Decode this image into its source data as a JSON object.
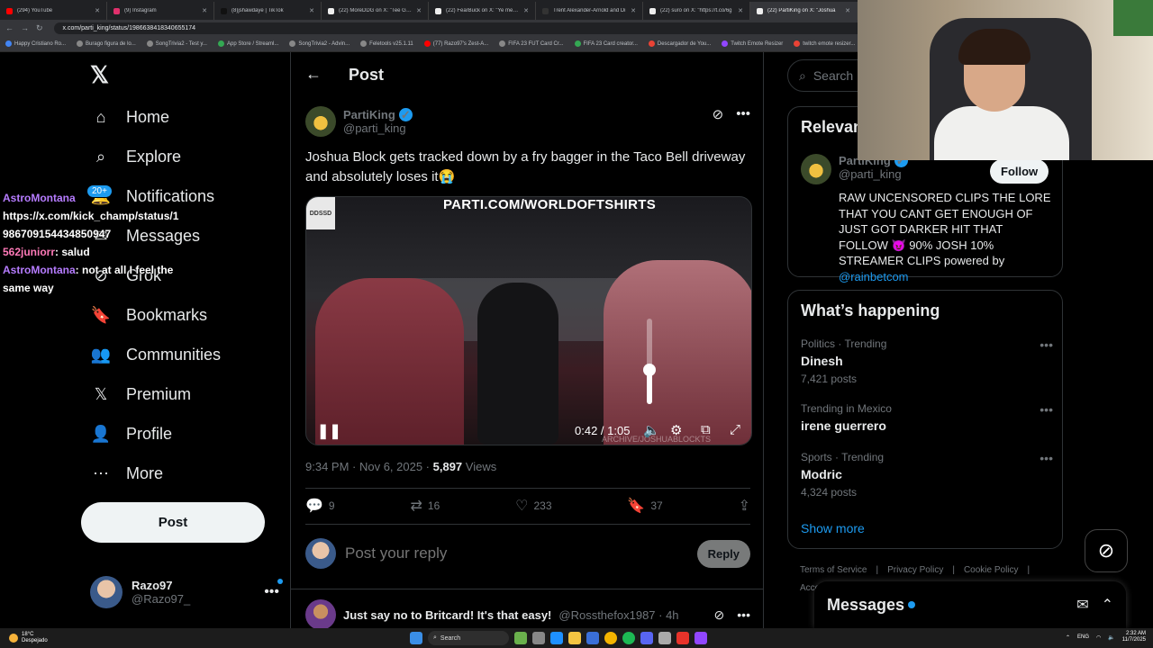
{
  "browser": {
    "tabs": [
      {
        "label": "(294) YouTube",
        "color": "#ff0000"
      },
      {
        "label": "(9) Instagram",
        "color": "#e1306c"
      },
      {
        "label": "(8)jshawdaye | TikTok",
        "color": "#111111"
      },
      {
        "label": "(22) MoreDDG on X: \"Tee Gsiss",
        "color": "#eeeeee"
      },
      {
        "label": "(22) FearBuck on X: \"Ye met wi",
        "color": "#eeeeee"
      },
      {
        "label": "Trent Alexander-Arnold and Di",
        "color": "#333333"
      },
      {
        "label": "(22) suro on X: \"https://t.co/6g",
        "color": "#eeeeee"
      },
      {
        "label": "(22) PartiKing on X: \"Joshua",
        "color": "#eeeeee",
        "active": true
      }
    ],
    "url": "x.com/parti_king/status/1986638418340655174",
    "bookmarks": [
      {
        "label": "Happy Cristiano Ro...",
        "color": "#4285f4"
      },
      {
        "label": "Burago figura de lo...",
        "color": "#888888"
      },
      {
        "label": "SongTrivia2 - Test y...",
        "color": "#888888"
      },
      {
        "label": "App Store / Streaml...",
        "color": "#34a853"
      },
      {
        "label": "SongTrivia2 - Advin...",
        "color": "#888888"
      },
      {
        "label": "Feletools v25.1.11",
        "color": "#888888"
      },
      {
        "label": "(77) Razo97's Zest-A...",
        "color": "#ff0000"
      },
      {
        "label": "FIFA 23 FUT Card Cr...",
        "color": "#888888"
      },
      {
        "label": "FIFA 23 Card creator...",
        "color": "#34a853"
      },
      {
        "label": "Descargador de You...",
        "color": "#ea4335"
      },
      {
        "label": "Twitch Emote Resizer",
        "color": "#9146ff"
      },
      {
        "label": "twitch emote resizer...",
        "color": "#ea4335"
      }
    ]
  },
  "nav": {
    "items": [
      {
        "label": "Home",
        "icon": "home-icon"
      },
      {
        "label": "Explore",
        "icon": "search-icon"
      },
      {
        "label": "Notifications",
        "icon": "bell-icon"
      },
      {
        "label": "Messages",
        "icon": "mail-icon"
      },
      {
        "label": "Grok",
        "icon": "grok-icon"
      },
      {
        "label": "Bookmarks",
        "icon": "bookmark-icon"
      },
      {
        "label": "Communities",
        "icon": "communities-icon"
      },
      {
        "label": "Premium",
        "icon": "x-icon"
      },
      {
        "label": "Profile",
        "icon": "person-icon"
      },
      {
        "label": "More",
        "icon": "more-circle-icon"
      }
    ],
    "notifications_badge": "20+",
    "post_label": "Post",
    "account": {
      "name": "Razo97",
      "handle": "@Razo97_"
    }
  },
  "chat_overlay": {
    "lines": [
      {
        "user": "AstroMontana",
        "text": ""
      },
      {
        "user": "",
        "text": "https://x.com/kick_champ/status/1986709154434850947"
      },
      {
        "user": "562juniorr",
        "text": ": salud"
      },
      {
        "user": "AstroMontana",
        "text": ": not at all I feel the same way"
      }
    ]
  },
  "main": {
    "title": "Post",
    "author": {
      "name": "PartiKing",
      "handle": "@parti_king"
    },
    "text": "Joshua Block gets tracked down by a fry bagger in the Taco Bell driveway and absolutely loses it😭",
    "video": {
      "brand": "PARTI.COM/WORLDOFTSHIRTS",
      "watermark": "DDSSD",
      "time": "0:42 / 1:05",
      "handle_watermark": "ARCHIVE/JOSHUABLOCKTS",
      "volume_level": 0.4
    },
    "timestamp": "9:34 PM · Nov 6, 2025 · ",
    "views_count": "5,897",
    "views_label": " Views",
    "stats": {
      "replies": "9",
      "reposts": "16",
      "likes": "233",
      "bookmarks": "37"
    },
    "reply_placeholder": "Post your reply",
    "reply_button": "Reply",
    "next_post": {
      "text": "Just say no to Britcard! It's that easy!",
      "handle": "@Rossthefox1987 · 4h"
    }
  },
  "right": {
    "search_placeholder": "Search",
    "relevant": {
      "title": "Relevant people",
      "name": "PartiKing",
      "handle": "@parti_king",
      "follow": "Follow",
      "bio": "RAW UNCENSORED CLIPS THE LORE THAT YOU CANT GET ENOUGH OF JUST GOT DARKER HIT THAT FOLLOW 😈 90% JOSH 10% STREAMER CLIPS powered by ",
      "bio_link": "@rainbetcom"
    },
    "happening": {
      "title": "What’s happening",
      "trends": [
        {
          "context": "Politics · Trending",
          "name": "Dinesh",
          "count": "7,421 posts"
        },
        {
          "context": "Trending in Mexico",
          "name": "irene guerrero",
          "count": ""
        },
        {
          "context": "Sports · Trending",
          "name": "Modric",
          "count": "4,324 posts"
        }
      ],
      "show_more": "Show more"
    },
    "footer": [
      "Terms of Service",
      "Privacy Policy",
      "Cookie Policy",
      "Acce"
    ],
    "messages_label": "Messages"
  },
  "taskbar": {
    "weather_temp": "18°C",
    "weather_desc": "Despejado",
    "search_label": "Search",
    "lang": "ENG",
    "time": "2:32 AM",
    "date": "11/7/2025"
  }
}
